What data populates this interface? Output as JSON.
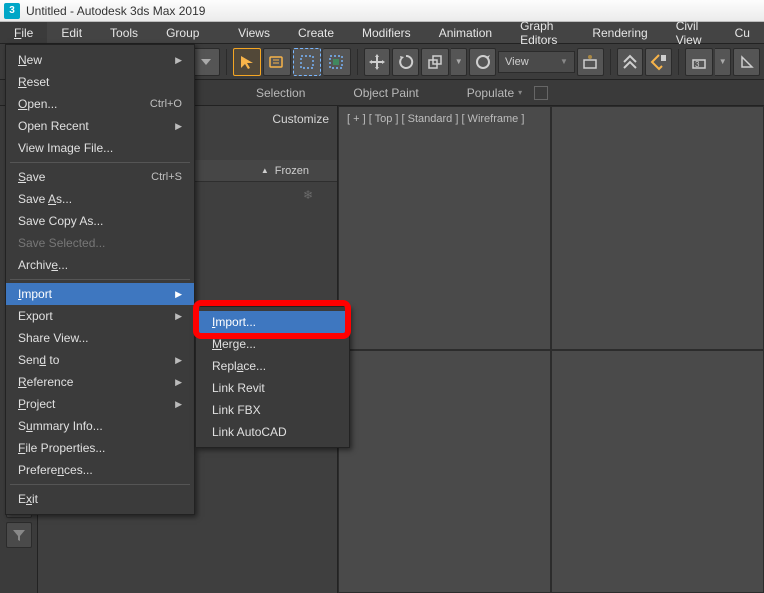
{
  "title": "Untitled - Autodesk 3ds Max 2019",
  "menus": {
    "file": "File",
    "edit": "Edit",
    "tools": "Tools",
    "group": "Group",
    "views": "Views",
    "create": "Create",
    "modifiers": "Modifiers",
    "animation": "Animation",
    "graph_editors": "Graph Editors",
    "rendering": "Rendering",
    "civil_view": "Civil View",
    "cust": "Cu"
  },
  "tabs": {
    "selection": "Selection",
    "object_paint": "Object Paint",
    "populate": "Populate"
  },
  "view_drop": "View",
  "panel": {
    "customize": "Customize",
    "frozen": "Frozen"
  },
  "viewport_label": "[ + ] [ Top ] [ Standard ] [ Wireframe ]",
  "file_menu": {
    "new": "New",
    "reset": "Reset",
    "open": "Open...",
    "open_sc": "Ctrl+O",
    "open_recent": "Open Recent",
    "view_image": "View Image File...",
    "save": "Save",
    "save_sc": "Ctrl+S",
    "save_as": "Save As...",
    "save_copy": "Save Copy As...",
    "save_selected": "Save Selected...",
    "archive": "Archive...",
    "import": "Import",
    "export": "Export",
    "share_view": "Share View...",
    "send_to": "Send to",
    "reference": "Reference",
    "project": "Project",
    "summary": "Summary Info...",
    "file_props": "File Properties...",
    "preferences": "Preferences...",
    "exit": "Exit"
  },
  "import_sub": {
    "import": "Import...",
    "merge": "Merge...",
    "replace": "Replace...",
    "link_revit": "Link Revit",
    "link_fbx": "Link FBX",
    "link_acad": "Link AutoCAD"
  }
}
